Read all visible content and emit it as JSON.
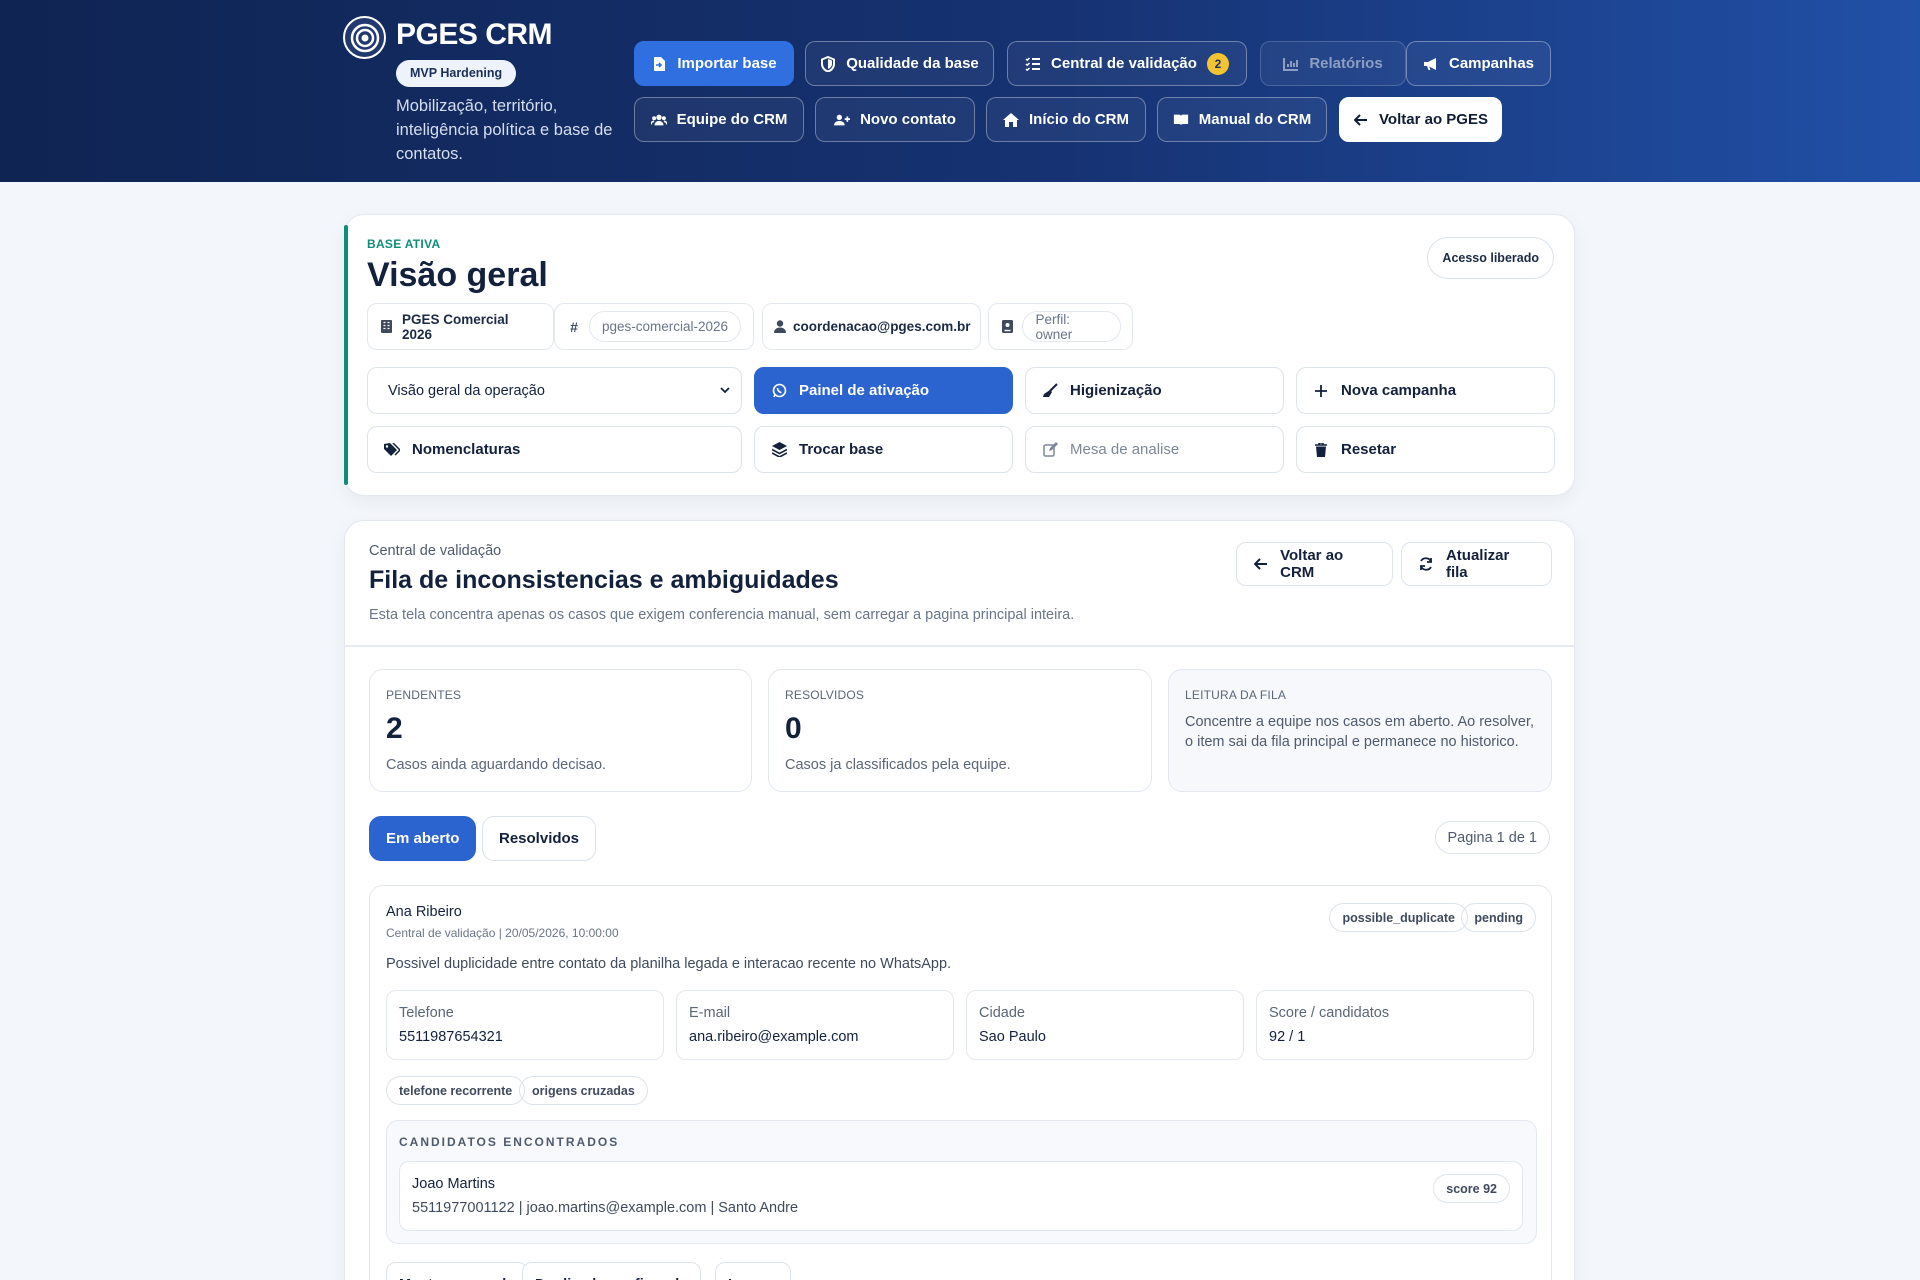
{
  "header": {
    "brand_title": "PGES CRM",
    "brand_badge": "MVP Hardening",
    "brand_subtitle": "Mobilização, território, inteligência política e base de contatos.",
    "nav_row1": [
      {
        "label": "Importar base",
        "icon": "file-import-icon"
      },
      {
        "label": "Qualidade da base",
        "icon": "shield-icon"
      },
      {
        "label": "Central de validação",
        "icon": "list-check-icon",
        "badge": "2"
      },
      {
        "label": "Relatórios",
        "icon": "chart-icon"
      },
      {
        "label": "Campanhas",
        "icon": "megaphone-icon"
      }
    ],
    "nav_row2": [
      {
        "label": "Equipe do CRM",
        "icon": "users-icon"
      },
      {
        "label": "Novo contato",
        "icon": "user-plus-icon"
      },
      {
        "label": "Início do CRM",
        "icon": "home-icon"
      },
      {
        "label": "Manual do CRM",
        "icon": "book-icon"
      },
      {
        "label": "Voltar ao PGES",
        "icon": "arrow-left-icon"
      }
    ]
  },
  "overview": {
    "eyebrow": "BASE ATIVA",
    "title": "Visão geral",
    "access": "Acesso liberado",
    "chips": {
      "base_name": "PGES Comercial 2026",
      "base_slug": "pges-comercial-2026",
      "email": "coordenacao@pges.com.br",
      "profile": "Perfil: owner"
    },
    "select_value": "Visão geral da operação",
    "buttons": {
      "activation": "Painel de ativação",
      "hygiene": "Higienização",
      "new_campaign": "Nova campanha",
      "nomenclatures": "Nomenclaturas",
      "switch_base": "Trocar base",
      "analysis_desk": "Mesa de analise",
      "reset": "Resetar"
    }
  },
  "validation": {
    "eyebrow": "Central de validação",
    "title": "Fila de inconsistencias e ambiguidades",
    "description": "Esta tela concentra apenas os casos que exigem conferencia manual, sem carregar a pagina principal inteira.",
    "back_button": "Voltar ao CRM",
    "refresh_button": "Atualizar fila",
    "stats": {
      "pending_label": "PENDENTES",
      "pending_value": "2",
      "pending_note": "Casos ainda aguardando decisao.",
      "resolved_label": "RESOLVIDOS",
      "resolved_value": "0",
      "resolved_note": "Casos ja classificados pela equipe.",
      "reading_label": "LEITURA DA FILA",
      "reading_text": "Concentre a equipe nos casos em aberto. Ao resolver, o item sai da fila principal e permanece no historico."
    },
    "tabs": {
      "open": "Em aberto",
      "resolved": "Resolvidos"
    },
    "pagination": "Pagina 1 de 1",
    "case": {
      "name": "Ana Ribeiro",
      "meta": "Central de validação | 20/05/2026, 10:00:00",
      "tag_type": "possible_duplicate",
      "tag_status": "pending",
      "description": "Possivel duplicidade entre contato da planilha legada e interacao recente no WhatsApp.",
      "fields": [
        {
          "label": "Telefone",
          "value": "5511987654321"
        },
        {
          "label": "E-mail",
          "value": "ana.ribeiro@example.com"
        },
        {
          "label": "Cidade",
          "value": "Sao Paulo"
        },
        {
          "label": "Score / candidatos",
          "value": "92 / 1"
        }
      ],
      "reasons": [
        "telefone recorrente",
        "origens cruzadas"
      ],
      "candidates_title": "CANDIDATOS ENCONTRADOS",
      "candidate": {
        "name": "Joao Martins",
        "info": "5511977001122 | joao.martins@example.com | Santo Andre",
        "score": "score 92"
      },
      "actions": [
        "Manter separado",
        "Duplicado confirmado",
        "Ignorar"
      ]
    }
  },
  "colors": {
    "header_start": "#0f2452",
    "header_end": "#2150a7",
    "primary": "#2b63cf",
    "accent_teal": "#0f8d7b",
    "badge_yellow": "#f3c432"
  }
}
